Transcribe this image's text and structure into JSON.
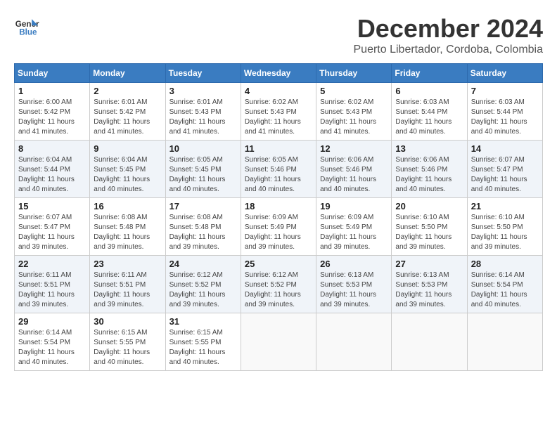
{
  "header": {
    "logo_line1": "General",
    "logo_line2": "Blue",
    "month": "December 2024",
    "location": "Puerto Libertador, Cordoba, Colombia"
  },
  "weekdays": [
    "Sunday",
    "Monday",
    "Tuesday",
    "Wednesday",
    "Thursday",
    "Friday",
    "Saturday"
  ],
  "weeks": [
    [
      {
        "day": "1",
        "sunrise": "6:00 AM",
        "sunset": "5:42 PM",
        "daylight": "11 hours and 41 minutes"
      },
      {
        "day": "2",
        "sunrise": "6:01 AM",
        "sunset": "5:42 PM",
        "daylight": "11 hours and 41 minutes"
      },
      {
        "day": "3",
        "sunrise": "6:01 AM",
        "sunset": "5:43 PM",
        "daylight": "11 hours and 41 minutes"
      },
      {
        "day": "4",
        "sunrise": "6:02 AM",
        "sunset": "5:43 PM",
        "daylight": "11 hours and 41 minutes"
      },
      {
        "day": "5",
        "sunrise": "6:02 AM",
        "sunset": "5:43 PM",
        "daylight": "11 hours and 41 minutes"
      },
      {
        "day": "6",
        "sunrise": "6:03 AM",
        "sunset": "5:44 PM",
        "daylight": "11 hours and 40 minutes"
      },
      {
        "day": "7",
        "sunrise": "6:03 AM",
        "sunset": "5:44 PM",
        "daylight": "11 hours and 40 minutes"
      }
    ],
    [
      {
        "day": "8",
        "sunrise": "6:04 AM",
        "sunset": "5:44 PM",
        "daylight": "11 hours and 40 minutes"
      },
      {
        "day": "9",
        "sunrise": "6:04 AM",
        "sunset": "5:45 PM",
        "daylight": "11 hours and 40 minutes"
      },
      {
        "day": "10",
        "sunrise": "6:05 AM",
        "sunset": "5:45 PM",
        "daylight": "11 hours and 40 minutes"
      },
      {
        "day": "11",
        "sunrise": "6:05 AM",
        "sunset": "5:46 PM",
        "daylight": "11 hours and 40 minutes"
      },
      {
        "day": "12",
        "sunrise": "6:06 AM",
        "sunset": "5:46 PM",
        "daylight": "11 hours and 40 minutes"
      },
      {
        "day": "13",
        "sunrise": "6:06 AM",
        "sunset": "5:46 PM",
        "daylight": "11 hours and 40 minutes"
      },
      {
        "day": "14",
        "sunrise": "6:07 AM",
        "sunset": "5:47 PM",
        "daylight": "11 hours and 40 minutes"
      }
    ],
    [
      {
        "day": "15",
        "sunrise": "6:07 AM",
        "sunset": "5:47 PM",
        "daylight": "11 hours and 39 minutes"
      },
      {
        "day": "16",
        "sunrise": "6:08 AM",
        "sunset": "5:48 PM",
        "daylight": "11 hours and 39 minutes"
      },
      {
        "day": "17",
        "sunrise": "6:08 AM",
        "sunset": "5:48 PM",
        "daylight": "11 hours and 39 minutes"
      },
      {
        "day": "18",
        "sunrise": "6:09 AM",
        "sunset": "5:49 PM",
        "daylight": "11 hours and 39 minutes"
      },
      {
        "day": "19",
        "sunrise": "6:09 AM",
        "sunset": "5:49 PM",
        "daylight": "11 hours and 39 minutes"
      },
      {
        "day": "20",
        "sunrise": "6:10 AM",
        "sunset": "5:50 PM",
        "daylight": "11 hours and 39 minutes"
      },
      {
        "day": "21",
        "sunrise": "6:10 AM",
        "sunset": "5:50 PM",
        "daylight": "11 hours and 39 minutes"
      }
    ],
    [
      {
        "day": "22",
        "sunrise": "6:11 AM",
        "sunset": "5:51 PM",
        "daylight": "11 hours and 39 minutes"
      },
      {
        "day": "23",
        "sunrise": "6:11 AM",
        "sunset": "5:51 PM",
        "daylight": "11 hours and 39 minutes"
      },
      {
        "day": "24",
        "sunrise": "6:12 AM",
        "sunset": "5:52 PM",
        "daylight": "11 hours and 39 minutes"
      },
      {
        "day": "25",
        "sunrise": "6:12 AM",
        "sunset": "5:52 PM",
        "daylight": "11 hours and 39 minutes"
      },
      {
        "day": "26",
        "sunrise": "6:13 AM",
        "sunset": "5:53 PM",
        "daylight": "11 hours and 39 minutes"
      },
      {
        "day": "27",
        "sunrise": "6:13 AM",
        "sunset": "5:53 PM",
        "daylight": "11 hours and 39 minutes"
      },
      {
        "day": "28",
        "sunrise": "6:14 AM",
        "sunset": "5:54 PM",
        "daylight": "11 hours and 40 minutes"
      }
    ],
    [
      {
        "day": "29",
        "sunrise": "6:14 AM",
        "sunset": "5:54 PM",
        "daylight": "11 hours and 40 minutes"
      },
      {
        "day": "30",
        "sunrise": "6:15 AM",
        "sunset": "5:55 PM",
        "daylight": "11 hours and 40 minutes"
      },
      {
        "day": "31",
        "sunrise": "6:15 AM",
        "sunset": "5:55 PM",
        "daylight": "11 hours and 40 minutes"
      },
      null,
      null,
      null,
      null
    ]
  ]
}
